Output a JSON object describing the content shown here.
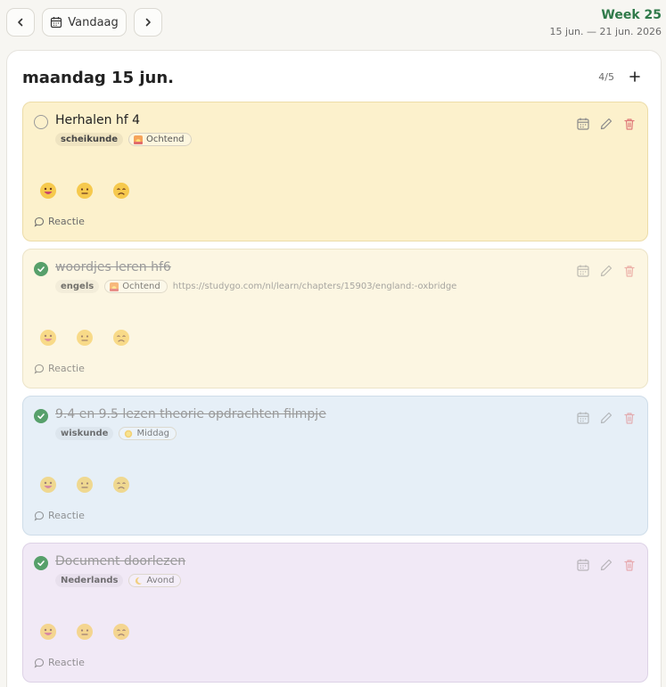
{
  "header": {
    "prev_label": "‹",
    "today_label": "Vandaag",
    "next_label": "›",
    "week_title": "Week 25",
    "week_range": "15 jun. — 21 jun. 2026"
  },
  "day": {
    "title": "maandag 15 jun.",
    "count": "4/5",
    "add_label": "+"
  },
  "tasks": [
    {
      "title": "Herhalen hf 4",
      "done": false,
      "subject": "scheikunde",
      "time": "Ochtend",
      "link": "",
      "comment": "Reactie",
      "color": "#fcf1cc"
    },
    {
      "title": "woordjes leren hf6",
      "done": true,
      "subject": "engels",
      "time": "Ochtend",
      "link": "https://studygo.com/nl/learn/chapters/15903/england:-oxbridge",
      "comment": "Reactie",
      "color": "#fcf6e2"
    },
    {
      "title": "9.4 en 9.5 lezen theorie opdrachten filmpje",
      "done": true,
      "subject": "wiskunde",
      "time": "Middag",
      "link": "",
      "comment": "Reactie",
      "color": "#e6eff7"
    },
    {
      "title": "Document doorlezen",
      "done": true,
      "subject": "Nederlands",
      "time": "Avond",
      "link": "",
      "comment": "Reactie",
      "color": "#f1e9f6"
    }
  ],
  "colors": {
    "accent_green": "#2f7a4a",
    "check_done": "#57a06b",
    "delete": "#e07a7a"
  },
  "icons": {
    "prev": "chevron-left-icon",
    "today": "calendar-icon",
    "next": "chevron-right-icon",
    "add": "plus-icon",
    "schedule": "calendar-icon",
    "edit": "pencil-icon",
    "delete": "trash-icon",
    "comment": "speech-bubble-icon",
    "emoji_happy": "grinning-face-icon",
    "emoji_neutral": "neutral-face-icon",
    "emoji_sad": "sad-face-icon",
    "ochtend": "sunrise-icon",
    "middag": "sun-icon",
    "avond": "moon-icon"
  }
}
